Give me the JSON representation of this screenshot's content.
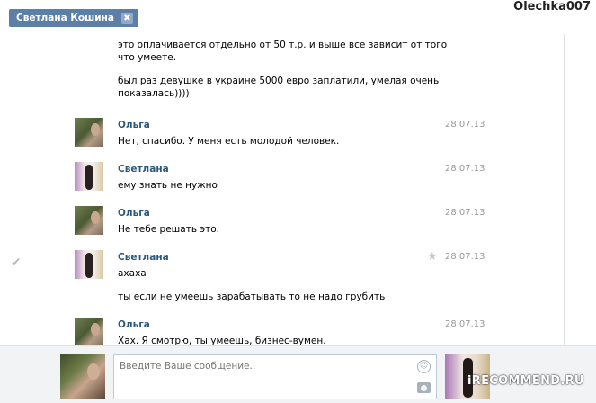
{
  "tab": {
    "title": "Светлана Кошина",
    "close_glyph": "✖"
  },
  "watermark_user": "Olechka007",
  "intro_lines": [
    "это оплачивается отдельно от 50 т.р. и выше все зависит от того",
    "что умеете.",
    "был раз девушке в украине 5000 евро заплатили, умелая очень",
    "показалась))))"
  ],
  "messages": [
    {
      "author": "Ольга",
      "date": "28.07.13",
      "lines": [
        "Нет, спасибо. У меня есть молодой человек."
      ]
    },
    {
      "author": "Светлана",
      "date": "28.07.13",
      "lines": [
        "ему знать не нужно"
      ]
    },
    {
      "author": "Ольга",
      "date": "28.07.13",
      "lines": [
        "Не тебе решать это."
      ]
    },
    {
      "author": "Светлана",
      "date": "28.07.13",
      "lines": [
        "ахаха",
        "ты если не умеешь зарабатывать то не надо грубить"
      ]
    },
    {
      "author": "Ольга",
      "date": "28.07.13",
      "lines": [
        "Хах. Я смотрю, ты умеешь, бизнес-вумен."
      ]
    }
  ],
  "icons": {
    "check": "check-icon",
    "star": "star-icon",
    "emoji": "smile-icon",
    "camera": "camera-icon"
  },
  "composer": {
    "placeholder": "Введите Ваше сообщение.."
  },
  "brand": "iRECOMMEND.RU"
}
